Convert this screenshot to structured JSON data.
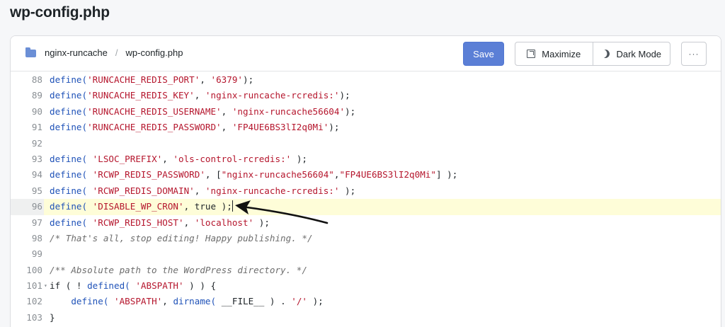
{
  "page": {
    "title": "wp-config.php"
  },
  "breadcrumb": {
    "folder_icon": "folder-icon",
    "folder": "nginx-runcache",
    "separator": "/",
    "file": "wp-config.php"
  },
  "toolbar": {
    "save_label": "Save",
    "maximize_label": "Maximize",
    "dark_mode_label": "Dark Mode",
    "more_label": "···",
    "accent_color": "#5b7fd6"
  },
  "editor": {
    "active_line": "96",
    "lines": [
      {
        "num": "88",
        "tokens": [
          [
            "define(",
            "k"
          ],
          [
            "'RUNCACHE_REDIS_PORT'",
            "s"
          ],
          [
            ", ",
            ""
          ],
          [
            "'6379'",
            "s"
          ],
          [
            ");",
            ""
          ]
        ]
      },
      {
        "num": "89",
        "tokens": [
          [
            "define(",
            "k"
          ],
          [
            "'RUNCACHE_REDIS_KEY'",
            "s"
          ],
          [
            ", ",
            ""
          ],
          [
            "'nginx-runcache-rcredis:'",
            "s"
          ],
          [
            ");",
            ""
          ]
        ]
      },
      {
        "num": "90",
        "tokens": [
          [
            "define(",
            "k"
          ],
          [
            "'RUNCACHE_REDIS_USERNAME'",
            "s"
          ],
          [
            ", ",
            ""
          ],
          [
            "'nginx-runcache56604'",
            "s"
          ],
          [
            ");",
            ""
          ]
        ]
      },
      {
        "num": "91",
        "tokens": [
          [
            "define(",
            "k"
          ],
          [
            "'RUNCACHE_REDIS_PASSWORD'",
            "s"
          ],
          [
            ", ",
            ""
          ],
          [
            "'FP4UE6BS3lI2q0Mi'",
            "s"
          ],
          [
            ");",
            ""
          ]
        ]
      },
      {
        "num": "92",
        "tokens": []
      },
      {
        "num": "93",
        "tokens": [
          [
            "define(",
            "k"
          ],
          [
            " ",
            ""
          ],
          [
            "'LSOC_PREFIX'",
            "s"
          ],
          [
            ", ",
            ""
          ],
          [
            "'ols-control-rcredis:'",
            "s"
          ],
          [
            " );",
            ""
          ]
        ]
      },
      {
        "num": "94",
        "tokens": [
          [
            "define(",
            "k"
          ],
          [
            " ",
            ""
          ],
          [
            "'RCWP_REDIS_PASSWORD'",
            "s"
          ],
          [
            ", [",
            ""
          ],
          [
            "\"nginx-runcache56604\"",
            "s"
          ],
          [
            ",",
            ""
          ],
          [
            "\"FP4UE6BS3lI2q0Mi\"",
            "s"
          ],
          [
            "] );",
            ""
          ]
        ]
      },
      {
        "num": "95",
        "tokens": [
          [
            "define(",
            "k"
          ],
          [
            " ",
            ""
          ],
          [
            "'RCWP_REDIS_DOMAIN'",
            "s"
          ],
          [
            ", ",
            ""
          ],
          [
            "'nginx-runcache-rcredis:'",
            "s"
          ],
          [
            " );",
            ""
          ]
        ]
      },
      {
        "num": "96",
        "tokens": [
          [
            "define(",
            "k"
          ],
          [
            " ",
            ""
          ],
          [
            "'DISABLE_WP_CRON'",
            "s"
          ],
          [
            ", true );",
            ""
          ]
        ]
      },
      {
        "num": "97",
        "tokens": [
          [
            "define(",
            "k"
          ],
          [
            " ",
            ""
          ],
          [
            "'RCWP_REDIS_HOST'",
            "s"
          ],
          [
            ", ",
            ""
          ],
          [
            "'localhost'",
            "s"
          ],
          [
            " );",
            ""
          ]
        ]
      },
      {
        "num": "98",
        "tokens": [
          [
            "/* That's all, stop editing! Happy publishing. */",
            "c"
          ]
        ]
      },
      {
        "num": "99",
        "tokens": []
      },
      {
        "num": "100",
        "tokens": [
          [
            "/** Absolute path to the WordPress directory. */",
            "c"
          ]
        ]
      },
      {
        "num": "101",
        "fold": "▾",
        "tokens": [
          [
            "if ( ! ",
            ""
          ],
          [
            "defined(",
            "k"
          ],
          [
            " ",
            ""
          ],
          [
            "'ABSPATH'",
            "s"
          ],
          [
            " ) ) {",
            ""
          ]
        ]
      },
      {
        "num": "102",
        "tokens": [
          [
            "    ",
            ""
          ],
          [
            "define(",
            "k"
          ],
          [
            " ",
            ""
          ],
          [
            "'ABSPATH'",
            "s"
          ],
          [
            ", ",
            ""
          ],
          [
            "dirname(",
            "k"
          ],
          [
            " __FILE__ ) . ",
            ""
          ],
          [
            "'/'",
            "s"
          ],
          [
            " );",
            ""
          ]
        ]
      },
      {
        "num": "103",
        "tokens": [
          [
            "}",
            ""
          ]
        ]
      }
    ]
  }
}
